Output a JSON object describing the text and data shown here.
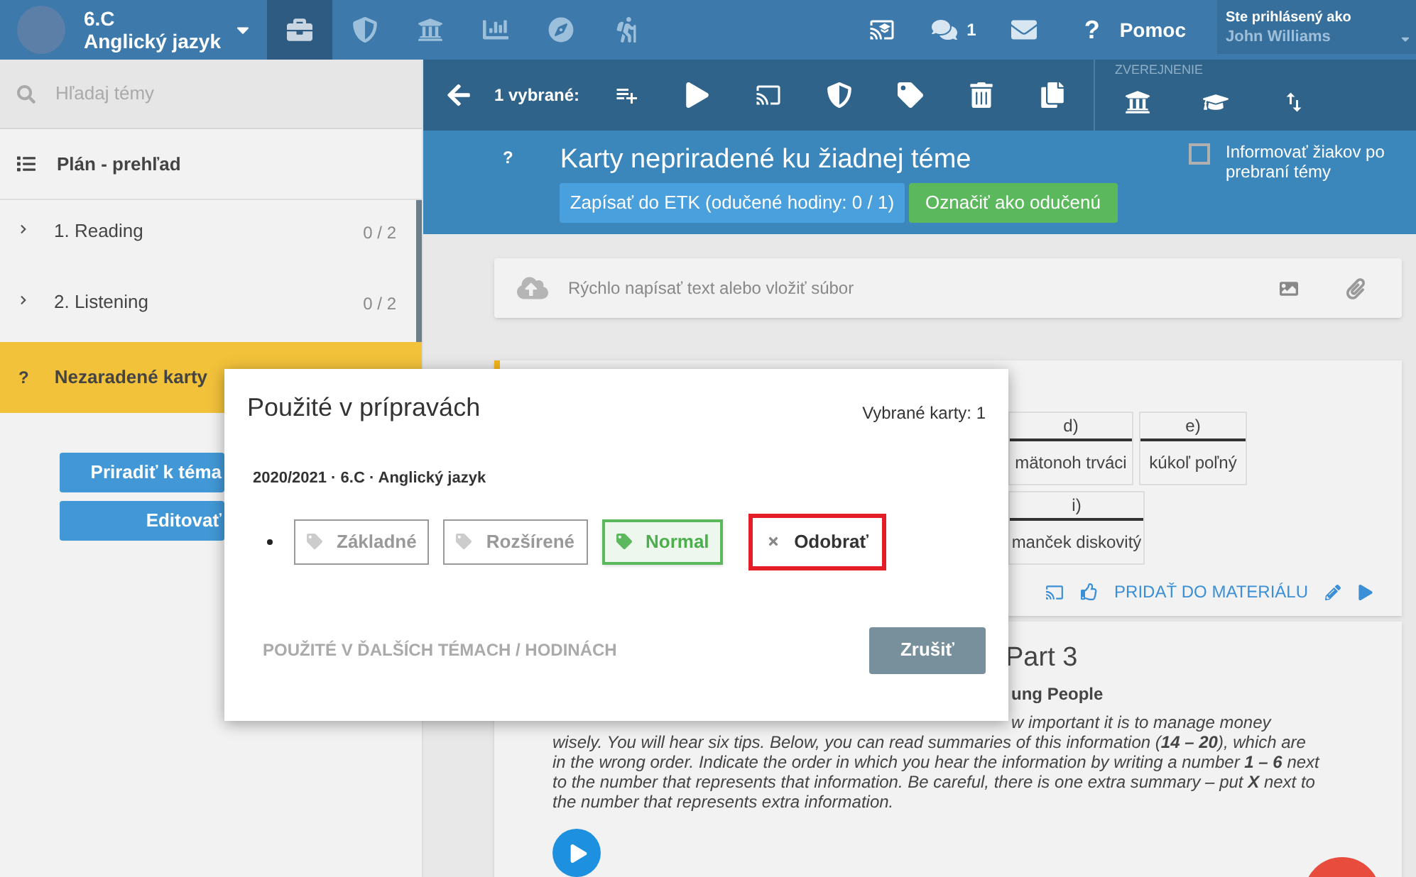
{
  "header": {
    "class_name": "6.C",
    "subject": "Anglický jazyk",
    "nav_tabs": [
      {
        "selected": true
      },
      {
        "selected": false
      },
      {
        "selected": false
      },
      {
        "selected": false
      },
      {
        "selected": false
      },
      {
        "selected": false
      }
    ],
    "messages_count": "1",
    "help_mark": "?",
    "help": "Pomoc",
    "user": {
      "label": "Ste prihlásený ako",
      "name": "John Williams"
    }
  },
  "sidebar": {
    "search_placeholder": "Hľadaj témy",
    "overview": "Plán - prehľad",
    "topics": [
      {
        "kind": "topic",
        "label": "1. Reading",
        "count": "0 / 2",
        "selected": false
      },
      {
        "kind": "topic",
        "label": "2. Listening",
        "count": "0 / 2",
        "selected": false
      },
      {
        "kind": "unassigned",
        "mark": "?",
        "label": "Nezaradené karty",
        "selected": true
      }
    ],
    "buttons": [
      "Priradiť k téma",
      "Editovať"
    ]
  },
  "toolbar": {
    "selection": "1 vybrané:",
    "publish_label": "ZVEREJNENIE"
  },
  "topic_header": {
    "help_mark": "?",
    "title": "Karty nepriradené ku žiadnej téme",
    "etk_button": "Zapísať do ETK (odučené hodiny: 0 / 1)",
    "done_button": "Označiť ako odučenú",
    "notify": {
      "label": "Informovať žiakov po prebraní témy",
      "checked": false
    }
  },
  "quick_input": {
    "placeholder": "Rýchlo napísať text alebo vložiť súbor"
  },
  "card_1": {
    "table_rows": [
      [
        {
          "header": "d)",
          "value": "mätonoh trváci"
        },
        {
          "header": "e)",
          "value": "kúkoľ poľný"
        }
      ],
      [
        {
          "header": "i)",
          "value": "manček diskovitý"
        }
      ]
    ],
    "add_link": "PRIDAŤ DO MATERIÁLU"
  },
  "card_2": {
    "title": "Part 3",
    "subtitle": "ung People",
    "instructions": "w important it is to manage money wisely. You will hear six tips. Below, you can read summaries of this information (**14 – 20**), which are in the wrong order. Indicate the order in which you hear the information by writing a number **1 – 6** next to the number that represents that information. Be careful, there is one extra summary – put **X** next to the number that represents extra information."
  },
  "dialog": {
    "title": "Použité v prípravách",
    "selected_count": "Vybrané karty: 1",
    "context": "2020/2021 · 6.C · Anglický jazyk",
    "levels": [
      {
        "label": "Základné",
        "selected": false
      },
      {
        "label": "Rozšírené",
        "selected": false
      },
      {
        "label": "Normal",
        "selected": true
      }
    ],
    "remove_button": "Odobrať",
    "other_uses_link": "POUŽITÉ V ĎALŠÍCH TÉMACH / HODINÁCH",
    "cancel_button": "Zrušiť"
  }
}
